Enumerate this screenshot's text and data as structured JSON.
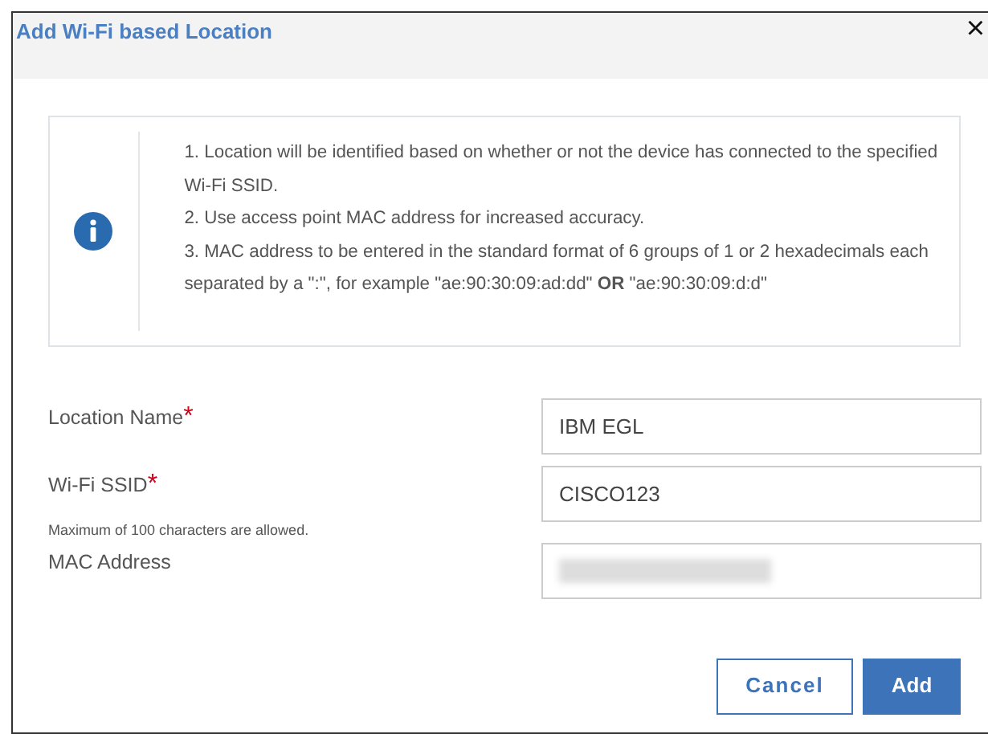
{
  "dialog": {
    "title": "Add Wi-Fi based Location",
    "close": "×"
  },
  "info": {
    "notes": [
      "1. Location will be identified based on whether or not the device has connected to the specified Wi-Fi SSID.",
      "2. Use access point MAC address for increased accuracy.",
      "3. MAC address to be entered in the standard format of 6 groups of 1 or 2 hexadecimals each separated by a \":\", for example \"ae:90:30:09:ad:dd\" **OR** \"ae:90:30:09:d:d\""
    ]
  },
  "fields": [
    {
      "label": "Location Name",
      "required_mark": "*",
      "value": "IBM EGL"
    },
    {
      "label": "Wi-Fi SSID",
      "required_mark": "*",
      "value": "CISCO123",
      "hint": "Maximum of 100 characters are allowed."
    },
    {
      "label": "MAC Address",
      "value_redacted": true
    }
  ],
  "buttons": [
    {
      "label": "Cancel",
      "kind": "secondary"
    },
    {
      "label": "Add",
      "kind": "primary"
    }
  ]
}
